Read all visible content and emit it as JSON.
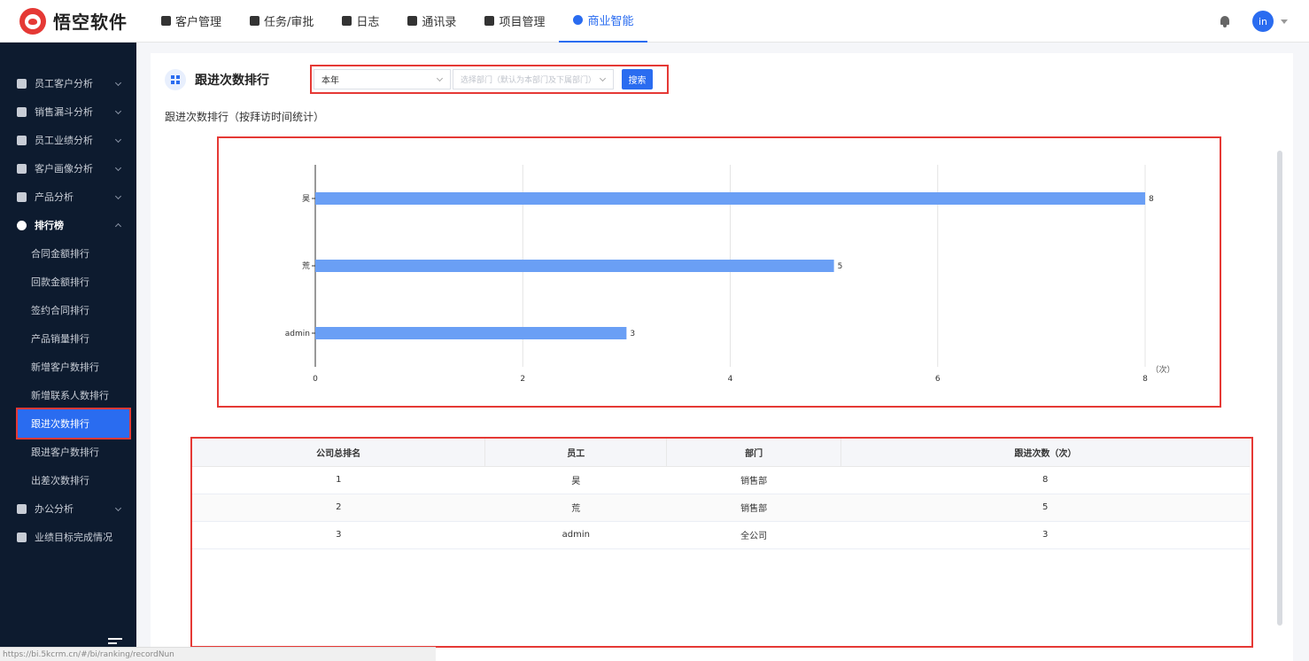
{
  "app": {
    "logo_text": "悟空软件",
    "nav": [
      {
        "label": "客户管理",
        "icon": "chart-icon"
      },
      {
        "label": "任务/审批",
        "icon": "briefcase-icon"
      },
      {
        "label": "日志",
        "icon": "log-icon"
      },
      {
        "label": "通讯录",
        "icon": "contacts-icon"
      },
      {
        "label": "项目管理",
        "icon": "project-icon"
      },
      {
        "label": "商业智能",
        "icon": "bi-icon",
        "active": true
      }
    ],
    "user_avatar": "in",
    "accent": "#2a6cf0"
  },
  "sidebar": {
    "groups": [
      {
        "label": "员工客户分析",
        "icon": "user-icon"
      },
      {
        "label": "销售漏斗分析",
        "icon": "funnel-icon"
      },
      {
        "label": "员工业绩分析",
        "icon": "bar-chart-icon"
      },
      {
        "label": "客户画像分析",
        "icon": "people-icon"
      },
      {
        "label": "产品分析",
        "icon": "box-icon"
      },
      {
        "label": "排行榜",
        "icon": "trophy-icon",
        "open": true
      }
    ],
    "ranking_items": [
      "合同金额排行",
      "回款金额排行",
      "签约合同排行",
      "产品销量排行",
      "新增客户数排行",
      "新增联系人数排行",
      "跟进次数排行",
      "跟进客户数排行",
      "出差次数排行"
    ],
    "active_item": "跟进次数排行",
    "bottom_groups": [
      {
        "label": "办公分析",
        "icon": "briefcase-icon"
      },
      {
        "label": "业绩目标完成情况",
        "icon": "target-icon"
      }
    ]
  },
  "status_url": "https://bi.5kcrm.cn/#/bi/ranking/recordNun",
  "page": {
    "title": "跟进次数排行",
    "filter": {
      "period_value": "本年",
      "dept_placeholder": "选择部门（默认为本部门及下属部门）",
      "search_label": "搜索"
    },
    "subtitle": "跟进次数排行（按拜访时间统计）"
  },
  "chart_data": {
    "type": "bar",
    "orientation": "horizontal",
    "categories": [
      "昊",
      "荒",
      "admin"
    ],
    "values": [
      8,
      5,
      3
    ],
    "xlim": [
      0,
      8
    ],
    "x_ticks": [
      "0",
      "2",
      "4",
      "6",
      "8"
    ],
    "x_unit": "（次）",
    "bar_color": "#6a9ff5",
    "grid": true
  },
  "table": {
    "headers": [
      "公司总排名",
      "员工",
      "部门",
      "跟进次数（次）"
    ],
    "rows": [
      [
        "1",
        "昊",
        "销售部",
        "8"
      ],
      [
        "2",
        "荒",
        "销售部",
        "5"
      ],
      [
        "3",
        "admin",
        "全公司",
        "3"
      ]
    ]
  }
}
